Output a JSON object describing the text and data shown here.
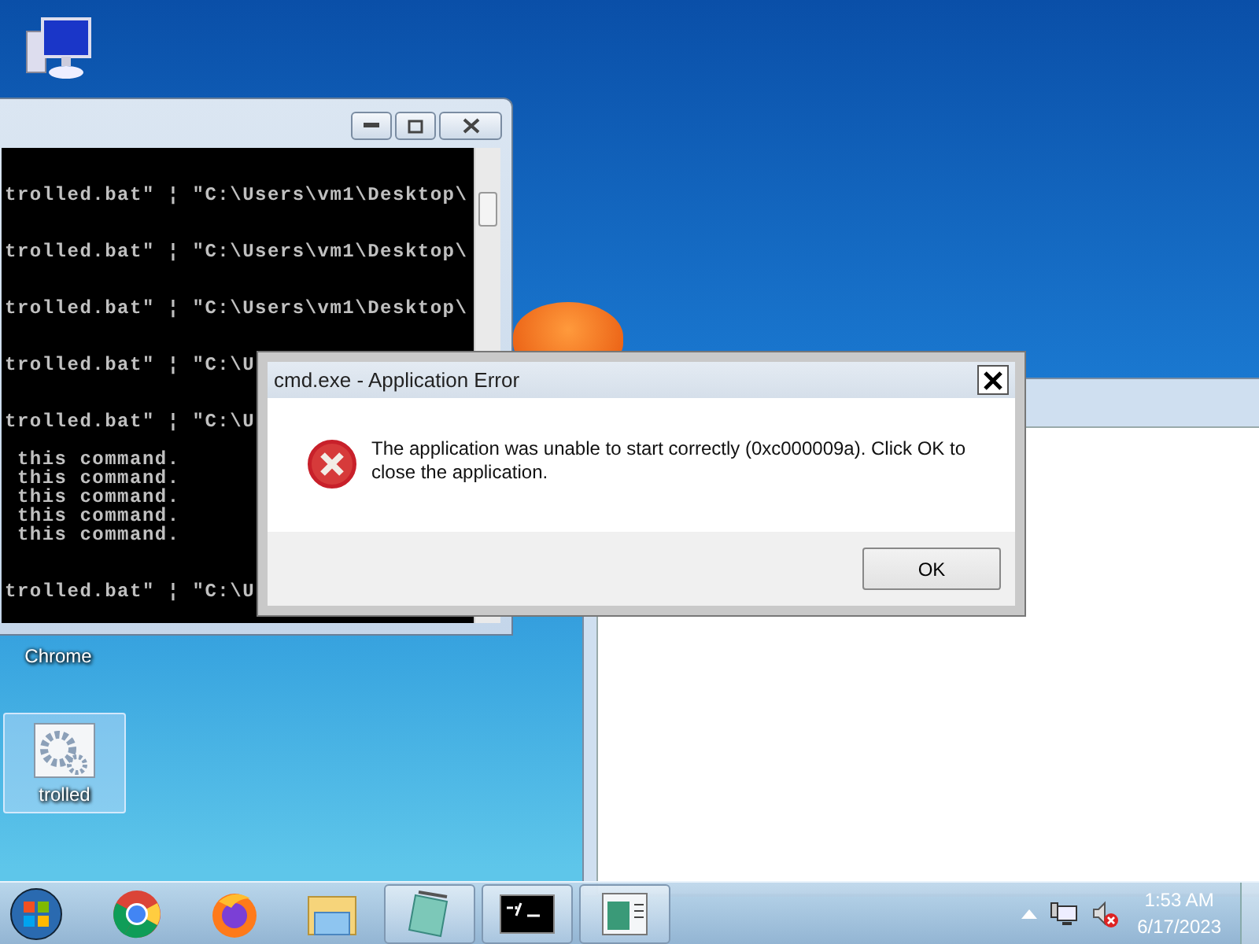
{
  "desktop_icons": [
    {
      "label": "Chrome",
      "selected": false
    },
    {
      "label": "trolled",
      "selected": true
    }
  ],
  "console_window": {
    "lines": [
      {
        "kind": "path",
        "text": "trolled.bat\" ¦ \"C:\\Users\\vm1\\Desktop\\"
      },
      {
        "kind": "path",
        "text": "trolled.bat\" ¦ \"C:\\Users\\vm1\\Desktop\\"
      },
      {
        "kind": "path",
        "text": "trolled.bat\" ¦ \"C:\\Users\\vm1\\Desktop\\"
      },
      {
        "kind": "path",
        "text": "trolled.bat\" ¦ \"C:\\U"
      },
      {
        "kind": "path",
        "text": "trolled.bat\" ¦ \"C:\\U"
      },
      {
        "kind": "message",
        "text": " this command."
      },
      {
        "kind": "message",
        "text": " this command."
      },
      {
        "kind": "message",
        "text": " this command."
      },
      {
        "kind": "message",
        "text": " this command."
      },
      {
        "kind": "message",
        "text": " this command."
      },
      {
        "kind": "path",
        "text": "trolled.bat\" ¦ \"C:\\U"
      }
    ]
  },
  "error_dialog": {
    "title": "cmd.exe - Application Error",
    "message": "The application was unable to start correctly (0xc000009a). Click OK to close the application.",
    "button": "OK"
  },
  "taskbar": {
    "items": [
      {
        "running": false
      },
      {
        "running": false
      },
      {
        "running": false
      },
      {
        "running": true
      },
      {
        "running": true
      },
      {
        "running": true
      }
    ],
    "clock": {
      "time": "1:53 AM",
      "date": "6/17/2023"
    }
  }
}
